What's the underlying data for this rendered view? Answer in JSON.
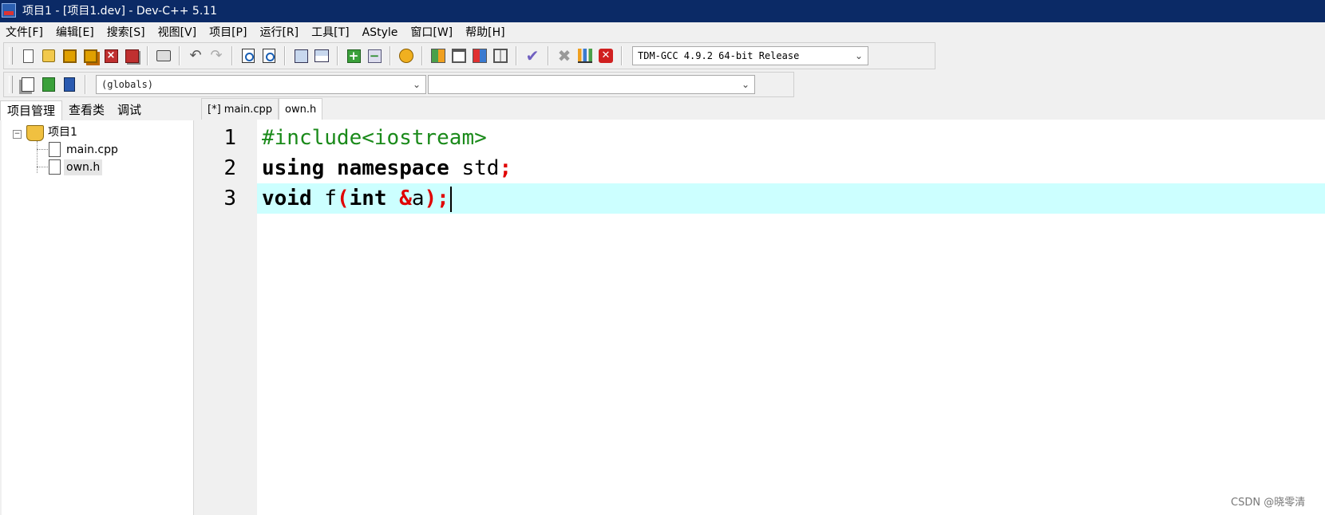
{
  "window": {
    "title": "项目1 - [项目1.dev] - Dev-C++ 5.11"
  },
  "menu": [
    "文件[F]",
    "编辑[E]",
    "搜索[S]",
    "视图[V]",
    "项目[P]",
    "运行[R]",
    "工具[T]",
    "AStyle",
    "窗口[W]",
    "帮助[H]"
  ],
  "toolbar": {
    "compiler": "TDM-GCC 4.9.2 64-bit Release",
    "globals": "(globals)",
    "members": ""
  },
  "left_panel": {
    "tabs": [
      "项目管理",
      "查看类",
      "调试"
    ],
    "tree": {
      "expander": "−",
      "project": "项目1",
      "files": [
        "main.cpp",
        "own.h"
      ]
    }
  },
  "editor": {
    "tabs": [
      "[*] main.cpp",
      "own.h"
    ],
    "active_tab": "own.h",
    "line_numbers": [
      "1",
      "2",
      "3"
    ],
    "current_line": 3,
    "code": {
      "line1": {
        "include": "#include<iostream>"
      },
      "line2": {
        "kw1": "using",
        "kw2": "namespace",
        "ident": "std",
        "semi": ";"
      },
      "line3": {
        "kw1": "void",
        "fname": "f",
        "lparen": "(",
        "kw2": "int",
        "amp": "&",
        "param": "a",
        "tail": ");"
      }
    }
  },
  "watermark": "CSDN @晓零清",
  "colors": {
    "titlebar": "#0b2a66",
    "current_line": "#ccffff",
    "preprocessor": "#1a8a1a",
    "symbol": "#e00000"
  }
}
